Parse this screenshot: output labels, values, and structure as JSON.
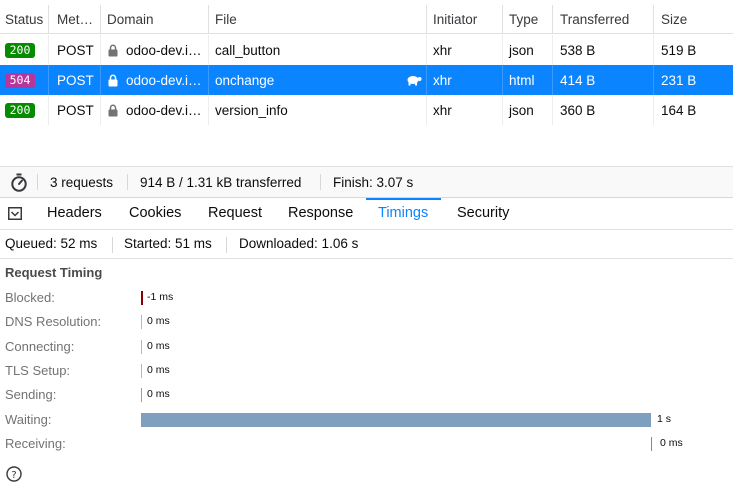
{
  "columns": [
    "Status",
    "Met…",
    "Domain",
    "File",
    "Initiator",
    "Type",
    "Transferred",
    "Size"
  ],
  "requests": [
    {
      "status": "200",
      "method": "POST",
      "domain": "odoo-dev.i…",
      "file": "call_button",
      "initiator": "xhr",
      "type": "json",
      "transferred": "538 B",
      "size": "519 B",
      "status_color": "#058b00",
      "selected": false
    },
    {
      "status": "504",
      "method": "POST",
      "domain": "odoo-dev.i…",
      "file": "onchange",
      "initiator": "xhr",
      "type": "html",
      "transferred": "414 B",
      "size": "231 B",
      "status_color": "#b8359d",
      "selected": true,
      "slow_icon": "turtle-icon"
    },
    {
      "status": "200",
      "method": "POST",
      "domain": "odoo-dev.i…",
      "file": "version_info",
      "initiator": "xhr",
      "type": "json",
      "transferred": "360 B",
      "size": "164 B",
      "status_color": "#058b00",
      "selected": false
    }
  ],
  "summary": {
    "requests": "3 requests",
    "transferred": "914 B / 1.31 kB transferred",
    "finish": "Finish: 3.07 s"
  },
  "tabs": [
    "Headers",
    "Cookies",
    "Request",
    "Response",
    "Timings",
    "Security"
  ],
  "active_tab": "Timings",
  "timing_summary": {
    "queued": "Queued: 52 ms",
    "started": "Started: 51 ms",
    "downloaded": "Downloaded: 1.06 s"
  },
  "request_timing": {
    "title": "Request Timing",
    "phases": [
      {
        "label": "Blocked:",
        "value": "-1 ms",
        "ms": -1,
        "color": "#8b0000"
      },
      {
        "label": "DNS Resolution:",
        "value": "0 ms",
        "ms": 0,
        "color": "#e4a5b2"
      },
      {
        "label": "Connecting:",
        "value": "0 ms",
        "ms": 0,
        "color": "#d8b07c"
      },
      {
        "label": "TLS Setup:",
        "value": "0 ms",
        "ms": 0,
        "color": "#d8b07c"
      },
      {
        "label": "Sending:",
        "value": "0 ms",
        "ms": 0,
        "color": "#5cb1e8"
      },
      {
        "label": "Waiting:",
        "value": "1 s",
        "ms": 1000,
        "color": "#7f9fbf"
      },
      {
        "label": "Receiving:",
        "value": "0 ms",
        "ms": 0,
        "color": "#4caf50"
      }
    ]
  },
  "colors": {
    "accent": "#0a84ff",
    "selected_row": "#0a84ff"
  }
}
